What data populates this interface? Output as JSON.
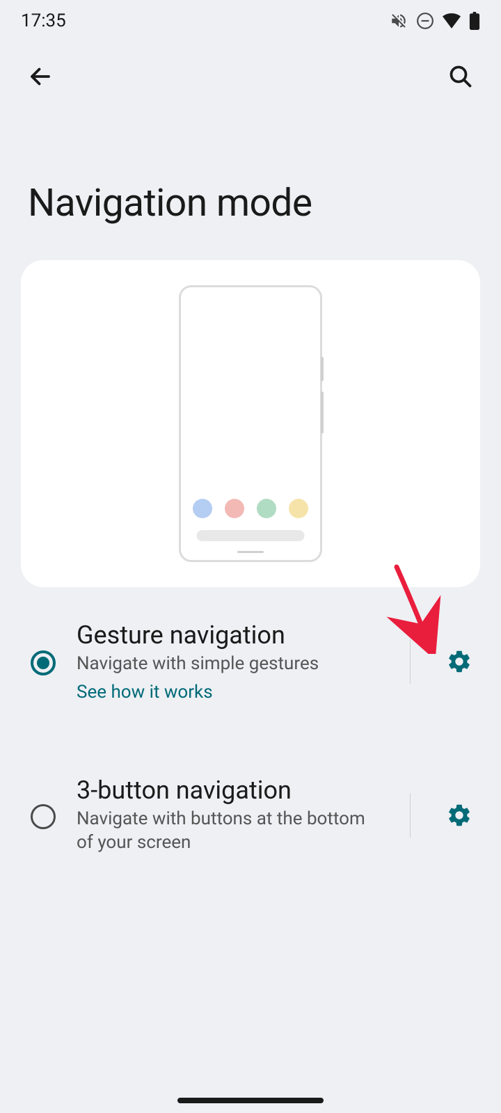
{
  "status": {
    "time": "17:35"
  },
  "header": {
    "title": "Navigation mode"
  },
  "options": [
    {
      "id": "gesture",
      "title": "Gesture navigation",
      "subtitle": "Navigate with simple gestures",
      "link": "See how it works",
      "selected": true
    },
    {
      "id": "three-button",
      "title": "3-button navigation",
      "subtitle": "Navigate with buttons at the bottom of your screen",
      "selected": false
    }
  ],
  "colors": {
    "accent": "#006a77",
    "background": "#eef0f4"
  }
}
